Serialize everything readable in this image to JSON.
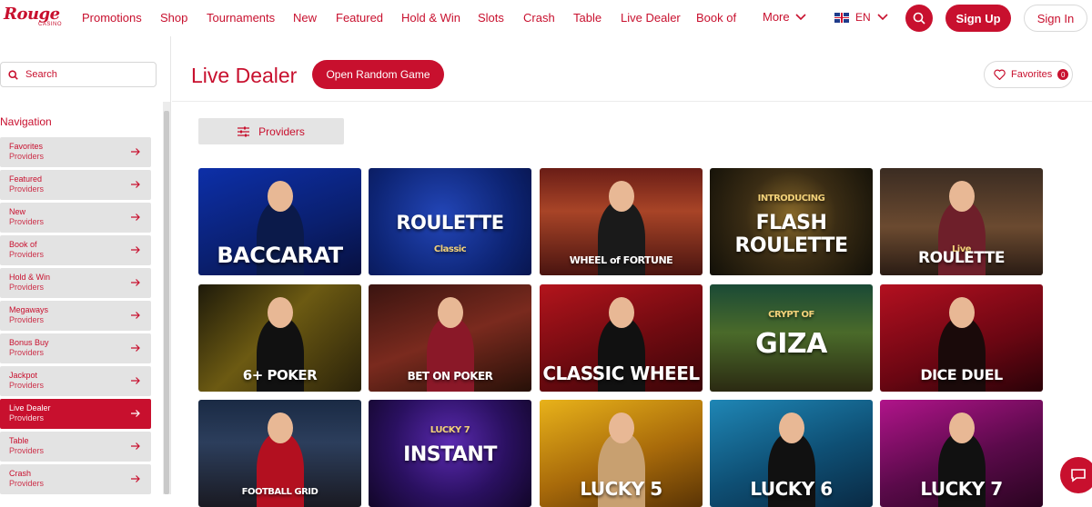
{
  "brand": {
    "name": "Rouge",
    "sub": "CASINO"
  },
  "topnav": [
    {
      "label": "Promotions",
      "id": "promotions"
    },
    {
      "label": "Shop",
      "id": "shop"
    },
    {
      "label": "Tournaments",
      "id": "tournaments"
    },
    {
      "label": "New",
      "id": "new"
    },
    {
      "label": "Featured",
      "id": "featured"
    },
    {
      "label": "Hold & Win",
      "id": "hold-win"
    },
    {
      "label": "Slots",
      "id": "slots"
    },
    {
      "label": "Crash",
      "id": "crash"
    },
    {
      "label": "Table",
      "id": "table"
    },
    {
      "label": "Live Dealer",
      "id": "live-dealer"
    },
    {
      "label": "Book of",
      "id": "book-of"
    }
  ],
  "more_label": "More",
  "language": "EN",
  "signup_label": "Sign Up",
  "signin_label": "Sign In",
  "sidebar": {
    "search_placeholder": "Search",
    "nav_title": "Navigation",
    "items": [
      {
        "label": "Favorites",
        "sub": "Providers",
        "active": false
      },
      {
        "label": "Featured",
        "sub": "Providers",
        "active": false
      },
      {
        "label": "New",
        "sub": "Providers",
        "active": false
      },
      {
        "label": "Book of",
        "sub": "Providers",
        "active": false
      },
      {
        "label": "Hold & Win",
        "sub": "Providers",
        "active": false
      },
      {
        "label": "Megaways",
        "sub": "Providers",
        "active": false
      },
      {
        "label": "Bonus Buy",
        "sub": "Providers",
        "active": false
      },
      {
        "label": "Jackpot",
        "sub": "Providers",
        "active": false
      },
      {
        "label": "Live Dealer",
        "sub": "Providers",
        "active": true
      },
      {
        "label": "Table",
        "sub": "Providers",
        "active": false
      },
      {
        "label": "Crash",
        "sub": "Providers",
        "active": false
      }
    ]
  },
  "main": {
    "title": "Live Dealer",
    "random_button": "Open Random Game",
    "favorites_label": "Favorites",
    "favorites_count": "0",
    "providers_label": "Providers"
  },
  "games": [
    {
      "title": "BACCARAT",
      "theme": "blue"
    },
    {
      "title": "ROULETTE",
      "subtitle": "Classic",
      "theme": "navy"
    },
    {
      "title": "WHEEL of FORTUNE",
      "theme": "red-studio"
    },
    {
      "title": "FLASH ROULETTE",
      "subtitle": "INTRODUCING",
      "theme": "dark-gold"
    },
    {
      "title": "ROULETTE",
      "subtitle": "Live",
      "theme": "studio-brown"
    },
    {
      "title": "6+ POKER",
      "theme": "gold"
    },
    {
      "title": "BET ON POKER",
      "theme": "dark-red"
    },
    {
      "title": "CLASSIC WHEEL",
      "theme": "red"
    },
    {
      "title": "GIZA",
      "subtitle": "CRYPT OF",
      "theme": "egypt"
    },
    {
      "title": "DICE DUEL",
      "theme": "crimson"
    },
    {
      "title": "FOOTBALL GRID",
      "theme": "stadium"
    },
    {
      "title": "INSTANT",
      "subtitle": "LUCKY 7",
      "theme": "purple"
    },
    {
      "title": "LUCKY 5",
      "theme": "yellow"
    },
    {
      "title": "LUCKY 6",
      "theme": "teal"
    },
    {
      "title": "LUCKY 7",
      "theme": "magenta"
    }
  ],
  "colors": {
    "accent": "#c8102e",
    "nav_bg": "#e3e3e3"
  }
}
